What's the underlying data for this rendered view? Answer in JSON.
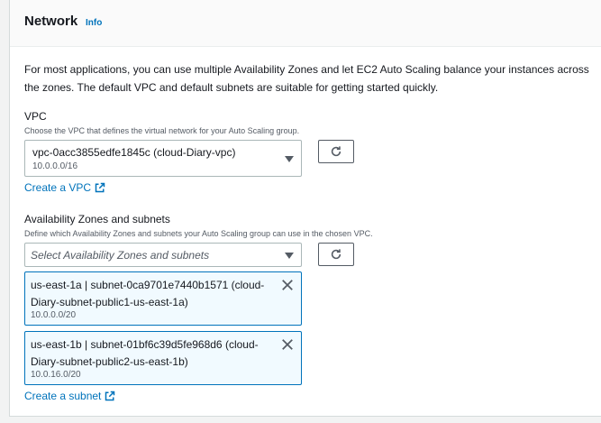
{
  "header": {
    "title": "Network",
    "info": "Info"
  },
  "description": "For most applications, you can use multiple Availability Zones and let EC2 Auto Scaling balance your instances across the zones. The default VPC and default subnets are suitable for getting started quickly.",
  "vpc": {
    "label": "VPC",
    "sublabel": "Choose the VPC that defines the virtual network for your Auto Scaling group.",
    "selected": "vpc-0acc3855edfe1845c (cloud-Diary-vpc)",
    "selected_sub": "10.0.0.0/16",
    "create_link": "Create a VPC"
  },
  "az": {
    "label": "Availability Zones and subnets",
    "sublabel": "Define which Availability Zones and subnets your Auto Scaling group can use in the chosen VPC.",
    "placeholder": "Select Availability Zones and subnets",
    "tokens": [
      {
        "label": "us-east-1a | subnet-0ca9701e7440b1571 (cloud-Diary-subnet-public1-us-east-1a)",
        "cidr": "10.0.0.0/20"
      },
      {
        "label": "us-east-1b | subnet-01bf6c39d5fe968d6 (cloud-Diary-subnet-public2-us-east-1b)",
        "cidr": "10.0.16.0/20"
      }
    ],
    "create_link": "Create a subnet"
  },
  "icons": {
    "refresh": "refresh-icon",
    "external": "external-link-icon",
    "dismiss": "close-icon",
    "caret": "caret-down-icon"
  },
  "colors": {
    "link": "#0073bb",
    "token_bg": "#f1faff",
    "token_border": "#0073bb"
  }
}
